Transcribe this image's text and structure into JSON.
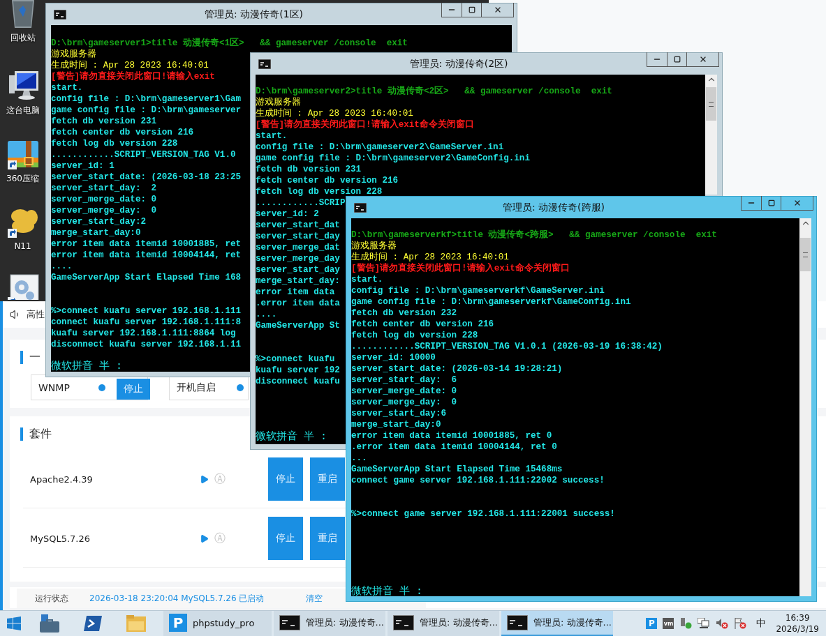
{
  "desktop_icons": [
    {
      "kind": "recycle-bin",
      "label": "回收站"
    },
    {
      "kind": "computer",
      "label": "这台电脑"
    },
    {
      "kind": "zip",
      "label": "360压缩"
    },
    {
      "kind": "app",
      "label": "N11"
    },
    {
      "kind": "settings"
    }
  ],
  "phpstudy": {
    "header": {
      "text": "高性"
    },
    "quick_start": {
      "heading": "一",
      "services": [
        {
          "name": "WNMP",
          "running": true,
          "button": "停止"
        },
        {
          "name": "开机自启",
          "running": true
        }
      ]
    },
    "suite": {
      "heading": "套件",
      "rows": [
        {
          "name": "Apache2.4.39",
          "auto": "Ⓐ",
          "buttons": [
            "停止",
            "重启"
          ]
        },
        {
          "name": "MySQL5.7.26",
          "auto": "Ⓐ",
          "buttons": [
            "停止",
            "重启"
          ]
        }
      ]
    },
    "log": {
      "label": "运行状态",
      "entry": "2026-03-18 23:20:04 MySQL5.7.26 已启动",
      "clear": "清空"
    }
  },
  "consoles": [
    {
      "title": "管理员: 动漫传奇(1区)",
      "active": false,
      "lines": [
        {
          "kind": "command",
          "text": "D:\\brm\\gameserver1>title 动漫传奇<1区>   && gameserver /console  exit"
        },
        {
          "kind": "info",
          "text": "游戏服务器"
        },
        {
          "kind": "info",
          "text": "生成时间 : Apr 28 2023 16:40:01"
        },
        {
          "kind": "warning",
          "text": "[警告]请勿直接关闭此窗口!请输入exit"
        },
        {
          "kind": "output",
          "text": "start."
        },
        {
          "kind": "output",
          "text": "config file : D:\\brm\\gameserver1\\Gam"
        },
        {
          "kind": "output",
          "text": "game config file : D:\\brm\\gameserver"
        },
        {
          "kind": "output",
          "text": "fetch db version 231"
        },
        {
          "kind": "output",
          "text": "fetch center db version 216"
        },
        {
          "kind": "output",
          "text": "fetch log db version 228"
        },
        {
          "kind": "output",
          "text": "............SCRIPT_VERSION_TAG V1.0"
        },
        {
          "kind": "output",
          "text": "server_id: 1"
        },
        {
          "kind": "output",
          "text": "server_start_date: (2026-03-18 23:25"
        },
        {
          "kind": "output",
          "text": "server_start_day:  2"
        },
        {
          "kind": "output",
          "text": "server_merge_date: 0"
        },
        {
          "kind": "output",
          "text": "server_merge_day:  0"
        },
        {
          "kind": "output",
          "text": "server_start_day:2"
        },
        {
          "kind": "output",
          "text": "merge_start_day:0"
        },
        {
          "kind": "output",
          "text": "error item data itemid 10001885, ret"
        },
        {
          "kind": "output",
          "text": "error item data itemid 10004144, ret"
        },
        {
          "kind": "output",
          "text": "...."
        },
        {
          "kind": "output",
          "text": "GameServerApp Start Elapsed Time 168"
        },
        {
          "kind": "blank"
        },
        {
          "kind": "blank"
        },
        {
          "kind": "output",
          "text": "%>connect kuafu server 192.168.1.111"
        },
        {
          "kind": "output",
          "text": "connect kuafu server 192.168.1.111:8"
        },
        {
          "kind": "output",
          "text": "kuafu server 192.168.1.111:8864 log"
        },
        {
          "kind": "output",
          "text": "disconnect kuafu server 192.168.1.11"
        },
        {
          "kind": "blank"
        },
        {
          "kind": "ime",
          "text": "微软拼音 半 :"
        }
      ]
    },
    {
      "title": "管理员: 动漫传奇(2区)",
      "active": false,
      "lines": [
        {
          "kind": "command",
          "text": "D:\\brm\\gameserver2>title 动漫传奇<2区>   && gameserver /console  exit"
        },
        {
          "kind": "info",
          "text": "游戏服务器"
        },
        {
          "kind": "info",
          "text": "生成时间 : Apr 28 2023 16:40:01"
        },
        {
          "kind": "warning",
          "text": "[警告]请勿直接关闭此窗口!请输入exit命令关闭窗口"
        },
        {
          "kind": "output",
          "text": "start."
        },
        {
          "kind": "output",
          "text": "config file : D:\\brm\\gameserver2\\GameServer.ini"
        },
        {
          "kind": "output",
          "text": "game config file : D:\\brm\\gameserver2\\GameConfig.ini"
        },
        {
          "kind": "output",
          "text": "fetch db version 231"
        },
        {
          "kind": "output",
          "text": "fetch center db version 216"
        },
        {
          "kind": "output",
          "text": "fetch log db version 228"
        },
        {
          "kind": "output",
          "text": "............SCRIP"
        },
        {
          "kind": "output",
          "text": "server_id: 2"
        },
        {
          "kind": "output",
          "text": "server_start_dat"
        },
        {
          "kind": "output",
          "text": "server_start_day"
        },
        {
          "kind": "output",
          "text": "server_merge_dat"
        },
        {
          "kind": "output",
          "text": "server_merge_day"
        },
        {
          "kind": "output",
          "text": "server_start_day"
        },
        {
          "kind": "output",
          "text": "merge_start_day:"
        },
        {
          "kind": "output",
          "text": "error item data"
        },
        {
          "kind": "output",
          "text": ".error item data"
        },
        {
          "kind": "output",
          "text": "...."
        },
        {
          "kind": "output",
          "text": "GameServerApp St"
        },
        {
          "kind": "blank"
        },
        {
          "kind": "blank"
        },
        {
          "kind": "output",
          "text": "%>connect kuafu"
        },
        {
          "kind": "output",
          "text": "kuafu server 192"
        },
        {
          "kind": "output",
          "text": "disconnect kuafu"
        },
        {
          "kind": "blank"
        },
        {
          "kind": "blank"
        },
        {
          "kind": "blank"
        },
        {
          "kind": "blank"
        },
        {
          "kind": "ime",
          "text": "微软拼音 半 :"
        }
      ]
    },
    {
      "title": "管理员: 动漫传奇(跨服)",
      "active": true,
      "lines": [
        {
          "kind": "command",
          "text": "D:\\brm\\gameserverkf>title 动漫传奇<跨服>   && gameserver /console  exit"
        },
        {
          "kind": "info",
          "text": "游戏服务器"
        },
        {
          "kind": "info",
          "text": "生成时间 : Apr 28 2023 16:40:01"
        },
        {
          "kind": "warning",
          "text": "[警告]请勿直接关闭此窗口!请输入exit命令关闭窗口"
        },
        {
          "kind": "output",
          "text": "start."
        },
        {
          "kind": "output",
          "text": "config file : D:\\brm\\gameserverkf\\GameServer.ini"
        },
        {
          "kind": "output",
          "text": "game config file : D:\\brm\\gameserverkf\\GameConfig.ini"
        },
        {
          "kind": "output",
          "text": "fetch db version 232"
        },
        {
          "kind": "output",
          "text": "fetch center db version 216"
        },
        {
          "kind": "output",
          "text": "fetch log db version 228"
        },
        {
          "kind": "output",
          "text": "............SCRIPT_VERSION_TAG V1.0.1 (2026-03-19 16:38:42)"
        },
        {
          "kind": "output",
          "text": "server_id: 10000"
        },
        {
          "kind": "output",
          "text": "server_start_date: (2026-03-14 19:28:21)"
        },
        {
          "kind": "output",
          "text": "server_start_day:  6"
        },
        {
          "kind": "output",
          "text": "server_merge_date: 0"
        },
        {
          "kind": "output",
          "text": "server_merge_day:  0"
        },
        {
          "kind": "output",
          "text": "server_start_day:6"
        },
        {
          "kind": "output",
          "text": "merge_start_day:0"
        },
        {
          "kind": "output",
          "text": "error item data itemid 10001885, ret 0"
        },
        {
          "kind": "output",
          "text": ".error item data itemid 10004144, ret 0"
        },
        {
          "kind": "output",
          "text": "..."
        },
        {
          "kind": "output",
          "text": "GameServerApp Start Elapsed Time 15468ms"
        },
        {
          "kind": "output",
          "text": "connect game server 192.168.1.111:22002 success!"
        },
        {
          "kind": "blank"
        },
        {
          "kind": "blank"
        },
        {
          "kind": "output",
          "text": "%>connect game server 192.168.1.111:22001 success!"
        },
        {
          "kind": "blank"
        },
        {
          "kind": "blank"
        },
        {
          "kind": "blank"
        },
        {
          "kind": "blank"
        },
        {
          "kind": "blank"
        },
        {
          "kind": "blank"
        },
        {
          "kind": "ime",
          "text": "微软拼音 半 :"
        }
      ]
    }
  ],
  "taskbar": {
    "pinned": [
      {
        "kind": "start"
      },
      {
        "kind": "server-manager"
      },
      {
        "kind": "powershell"
      },
      {
        "kind": "explorer"
      }
    ],
    "buttons": [
      {
        "kind": "app",
        "logo": "P",
        "label": "phpstudy_pro",
        "selected": false
      },
      {
        "kind": "console",
        "label": "管理员: 动漫传奇...",
        "selected": false
      },
      {
        "kind": "console",
        "label": "管理员: 动漫传奇...",
        "selected": false
      },
      {
        "kind": "console",
        "label": "管理员: 动漫传奇...",
        "selected": true
      }
    ],
    "tray": {
      "icons": [
        {
          "kind": "phpstudy",
          "text": "P"
        },
        {
          "kind": "vmware",
          "text": "vm"
        },
        {
          "kind": "usb"
        },
        {
          "kind": "network"
        },
        {
          "kind": "volume"
        },
        {
          "kind": "flag"
        }
      ],
      "ime": "中",
      "time": "16:39",
      "date": "2026/3/19"
    }
  }
}
